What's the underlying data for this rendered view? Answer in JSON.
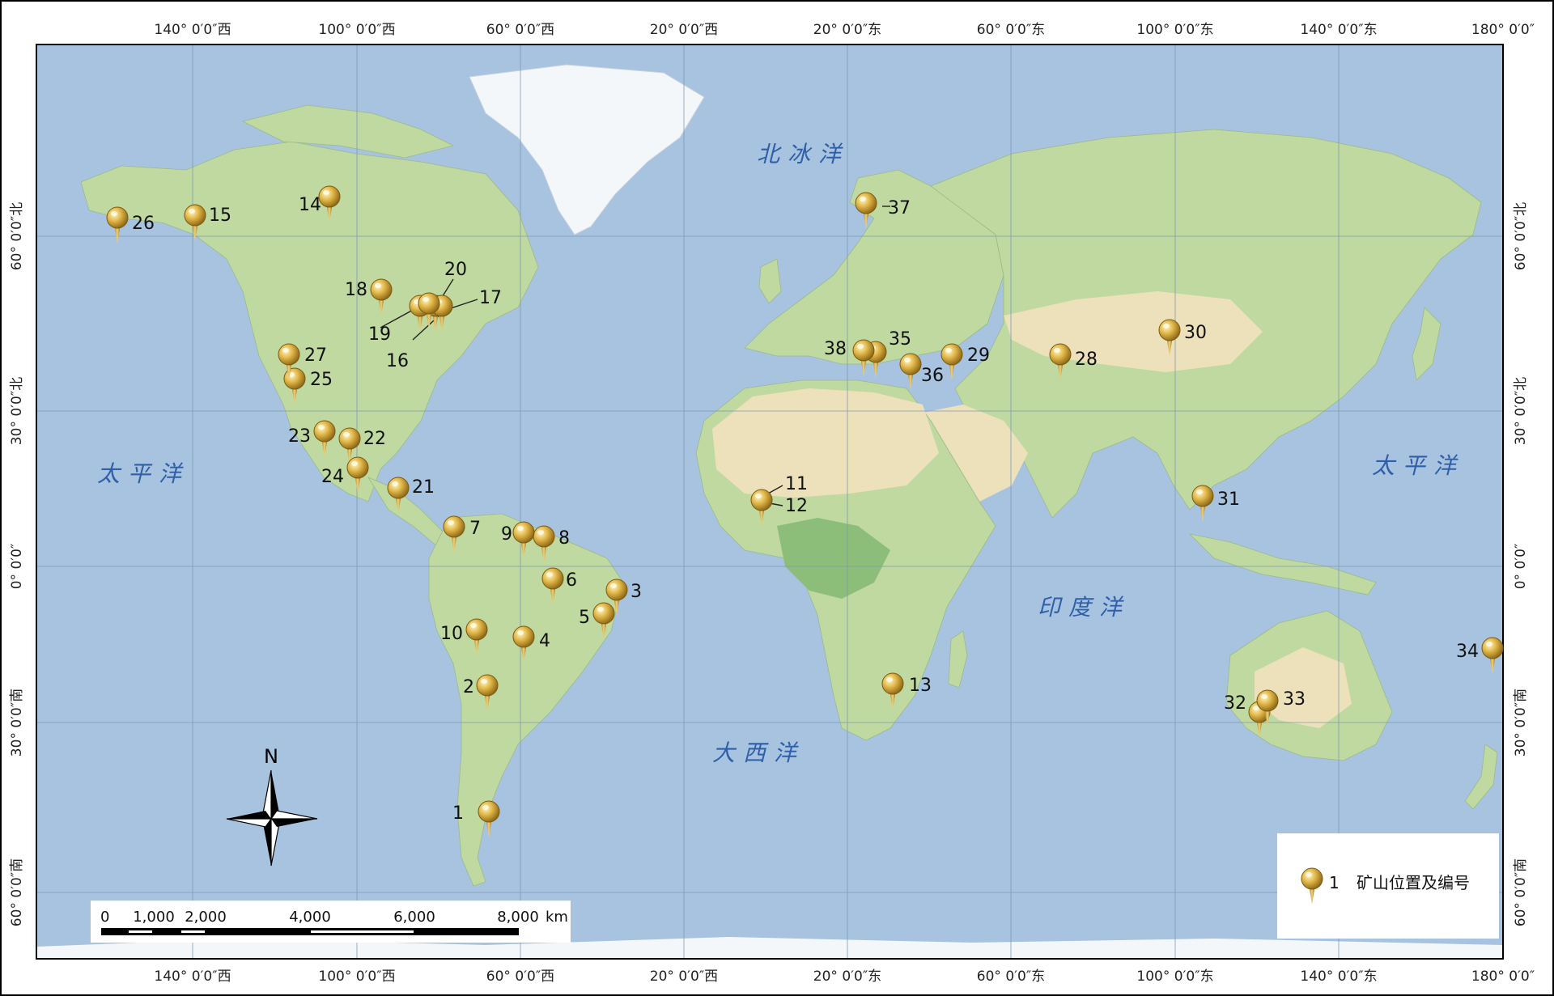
{
  "map": {
    "top_axis": [
      "140° 0′0″西",
      "100° 0′0″西",
      "60° 0′0″西",
      "20° 0′0″西",
      "20° 0′0″东",
      "60° 0′0″东",
      "100° 0′0″东",
      "140° 0′0″东",
      "180° 0′0″"
    ],
    "bottom_axis": [
      "140° 0′0″西",
      "100° 0′0″西",
      "60° 0′0″西",
      "20° 0′0″西",
      "20° 0′0″东",
      "60° 0′0″东",
      "100° 0′0″东",
      "140° 0′0″东",
      "180° 0′0″"
    ],
    "left_axis": [
      "60° 0′0″北",
      "30° 0′0″北",
      "0° 0′0″",
      "30° 0′0″南",
      "60° 0′0″南"
    ],
    "right_axis": [
      "60° 0′0″北",
      "30° 0′0″北",
      "0° 0′0″",
      "30° 0′0″南",
      "60° 0′0″南"
    ],
    "oceans": {
      "arctic": "北冰洋",
      "pacific_west": "太平洋",
      "pacific_east": "太平洋",
      "atlantic": "大西洋",
      "indian": "印度洋"
    },
    "north_label": "N",
    "scale_bar": {
      "labels": [
        "0",
        "1,000",
        "2,000",
        "4,000",
        "6,000",
        "8,000"
      ],
      "unit": "km"
    },
    "legend": {
      "number": "1",
      "label": "矿山位置及编号"
    },
    "mines": [
      {
        "id": "1",
        "name": "1"
      },
      {
        "id": "2",
        "name": "2"
      },
      {
        "id": "3",
        "name": "3"
      },
      {
        "id": "4",
        "name": "4"
      },
      {
        "id": "5",
        "name": "5"
      },
      {
        "id": "6",
        "name": "6"
      },
      {
        "id": "7",
        "name": "7"
      },
      {
        "id": "8",
        "name": "8"
      },
      {
        "id": "9",
        "name": "9"
      },
      {
        "id": "10",
        "name": "10"
      },
      {
        "id": "11",
        "name": "11"
      },
      {
        "id": "12",
        "name": "12"
      },
      {
        "id": "13",
        "name": "13"
      },
      {
        "id": "14",
        "name": "14"
      },
      {
        "id": "15",
        "name": "15"
      },
      {
        "id": "16",
        "name": "16"
      },
      {
        "id": "17",
        "name": "17"
      },
      {
        "id": "18",
        "name": "18"
      },
      {
        "id": "19",
        "name": "19"
      },
      {
        "id": "20",
        "name": "20"
      },
      {
        "id": "21",
        "name": "21"
      },
      {
        "id": "22",
        "name": "22"
      },
      {
        "id": "23",
        "name": "23"
      },
      {
        "id": "24",
        "name": "24"
      },
      {
        "id": "25",
        "name": "25"
      },
      {
        "id": "26",
        "name": "26"
      },
      {
        "id": "27",
        "name": "27"
      },
      {
        "id": "28",
        "name": "28"
      },
      {
        "id": "29",
        "name": "29"
      },
      {
        "id": "30",
        "name": "30"
      },
      {
        "id": "31",
        "name": "31"
      },
      {
        "id": "32",
        "name": "32"
      },
      {
        "id": "33",
        "name": "33"
      },
      {
        "id": "34",
        "name": "34"
      },
      {
        "id": "35",
        "name": "35"
      },
      {
        "id": "36",
        "name": "36"
      },
      {
        "id": "37",
        "name": "37"
      },
      {
        "id": "38",
        "name": "38"
      }
    ],
    "colors": {
      "ocean": "#a7c3e0",
      "land": "#bfd9a0",
      "desert": "#ede1bb",
      "forest": "#8cbe7a",
      "ice": "#f4f7fa",
      "pin": "#d4a52a",
      "grid": "#7f98b3"
    }
  }
}
